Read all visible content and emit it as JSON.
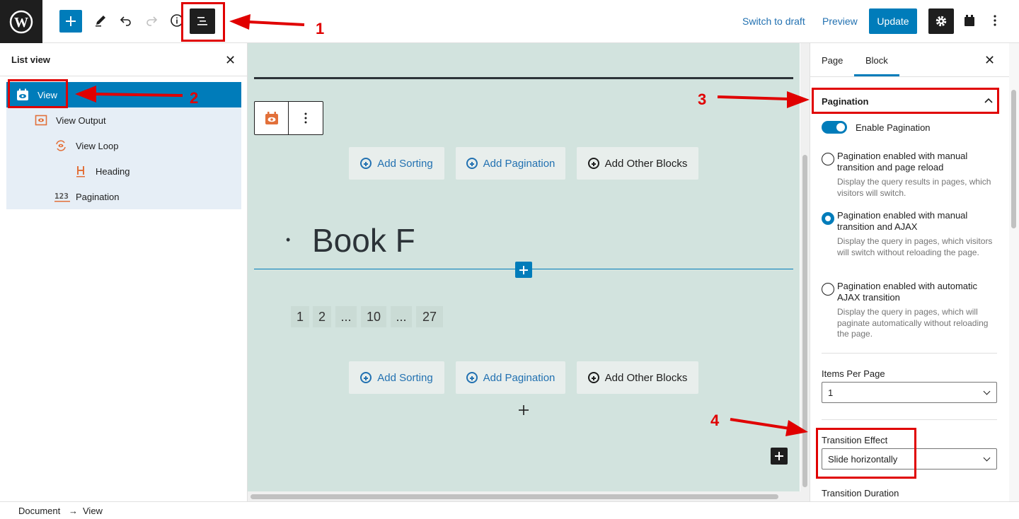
{
  "header": {
    "switch_to_draft": "Switch to draft",
    "preview": "Preview",
    "update": "Update"
  },
  "annotations": {
    "n1": "1",
    "n2": "2",
    "n3": "3",
    "n4": "4"
  },
  "list_view": {
    "title": "List view",
    "items": [
      {
        "label": "View"
      },
      {
        "label": "View Output"
      },
      {
        "label": "View Loop"
      },
      {
        "label": "Heading"
      },
      {
        "label": "Pagination"
      }
    ]
  },
  "canvas": {
    "add_sorting": "Add Sorting",
    "add_pagination": "Add Pagination",
    "add_other_blocks": "Add Other Blocks",
    "bullet": "•",
    "book_title": "Book F",
    "pagination": [
      "1",
      "2",
      "...",
      "10",
      "...",
      "27"
    ]
  },
  "sidebar": {
    "tab_page": "Page",
    "tab_block": "Block",
    "section_title": "Pagination",
    "enable_label": "Enable Pagination",
    "options": [
      {
        "title": "Pagination enabled with manual transition and page reload",
        "help": "Display the query results in pages, which visitors will switch."
      },
      {
        "title": "Pagination enabled with manual transition and AJAX",
        "help": "Display the query in pages, which visitors will switch without reloading the page."
      },
      {
        "title": "Pagination enabled with automatic AJAX transition",
        "help": "Display the query in pages, which will paginate automatically without reloading the page."
      }
    ],
    "items_per_page_label": "Items Per Page",
    "items_per_page_value": "1",
    "transition_effect_label": "Transition Effect",
    "transition_effect_value": "Slide horizontally",
    "transition_duration_label": "Transition Duration"
  },
  "footer": {
    "breadcrumb_document": "Document",
    "arrow": "→",
    "breadcrumb_view": "View"
  },
  "colors": {
    "accent": "#007cba",
    "annotation": "#e00000",
    "canvas_bg": "#d2e3de",
    "view_icon": "#e2703a"
  }
}
